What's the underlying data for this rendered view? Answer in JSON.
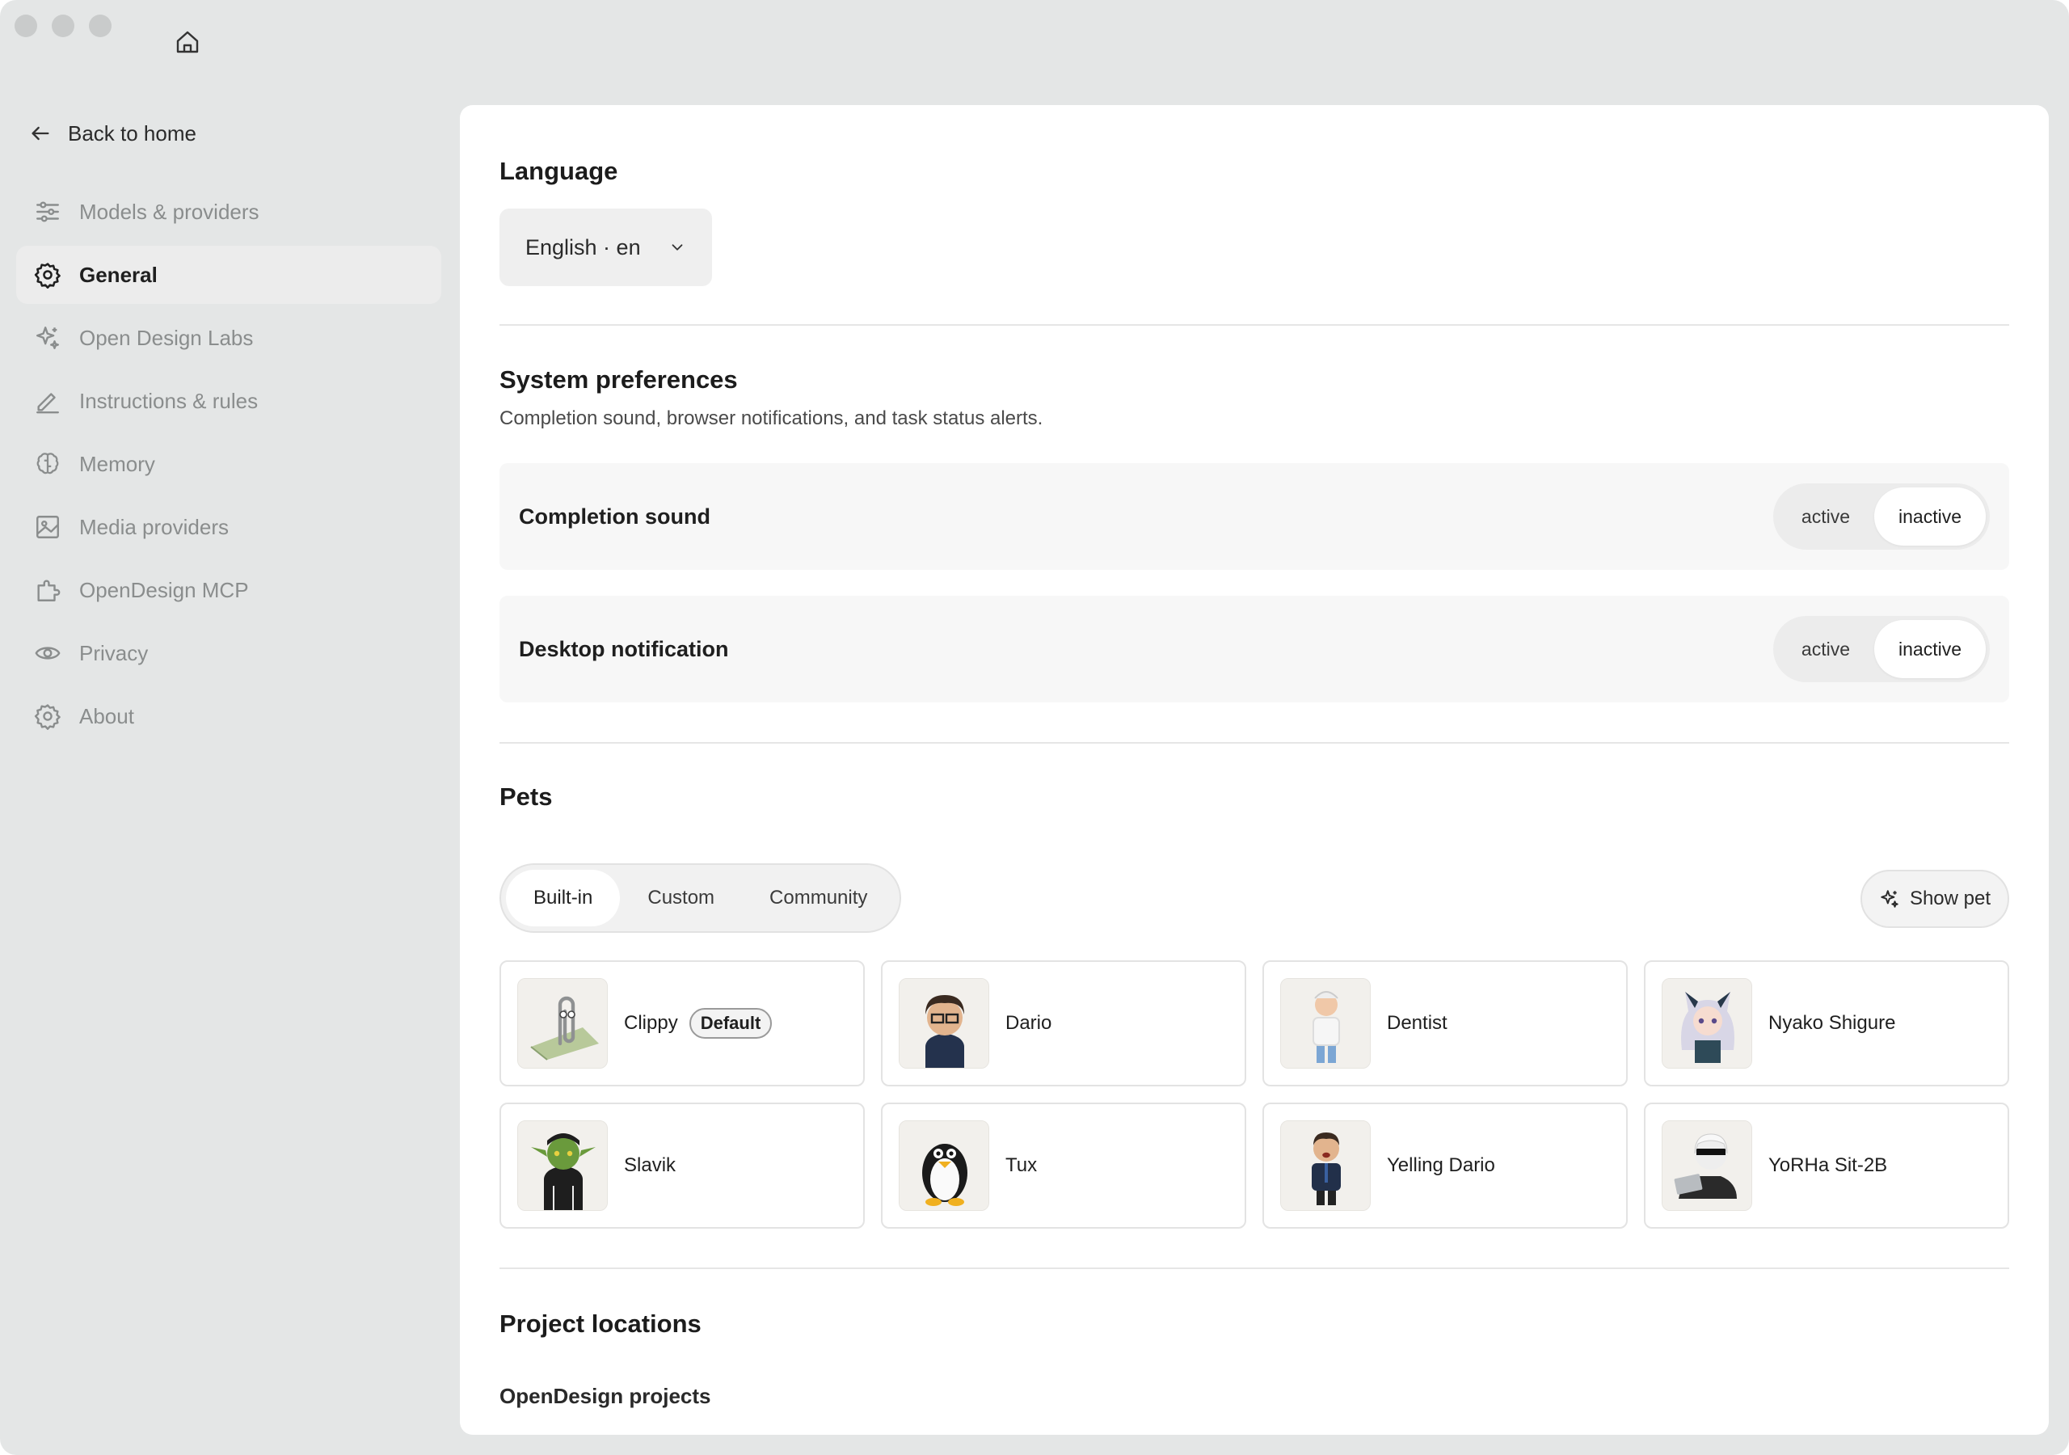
{
  "sidebar": {
    "back_label": "Back to home",
    "items": [
      {
        "label": "Models & providers",
        "icon": "sliders-icon"
      },
      {
        "label": "General",
        "icon": "gear-icon",
        "active": true
      },
      {
        "label": "Open Design Labs",
        "icon": "sparkles-icon"
      },
      {
        "label": "Instructions & rules",
        "icon": "pencil-icon"
      },
      {
        "label": "Memory",
        "icon": "brain-icon"
      },
      {
        "label": "Media providers",
        "icon": "image-icon"
      },
      {
        "label": "OpenDesign MCP",
        "icon": "plugin-icon"
      },
      {
        "label": "Privacy",
        "icon": "eye-icon"
      },
      {
        "label": "About",
        "icon": "gear-icon"
      }
    ]
  },
  "language": {
    "title": "Language",
    "selected": "English · en"
  },
  "system": {
    "title": "System preferences",
    "description": "Completion sound, browser notifications, and task status alerts.",
    "rows": [
      {
        "label": "Completion sound",
        "active_label": "active",
        "inactive_label": "inactive",
        "value": "inactive"
      },
      {
        "label": "Desktop notification",
        "active_label": "active",
        "inactive_label": "inactive",
        "value": "inactive"
      }
    ]
  },
  "pets": {
    "title": "Pets",
    "tabs": [
      "Built-in",
      "Custom",
      "Community"
    ],
    "selected_tab": "Built-in",
    "show_pet_label": "Show pet",
    "default_badge": "Default",
    "items": [
      {
        "name": "Clippy",
        "is_default": true
      },
      {
        "name": "Dario"
      },
      {
        "name": "Dentist"
      },
      {
        "name": "Nyako Shigure"
      },
      {
        "name": "Slavik"
      },
      {
        "name": "Tux"
      },
      {
        "name": "Yelling Dario"
      },
      {
        "name": "YoRHa Sit-2B"
      }
    ]
  },
  "locations": {
    "title": "Project locations",
    "subtitle": "OpenDesign projects"
  },
  "colors": {
    "window_bg": "#e4e6e6",
    "panel_bg": "#ffffff",
    "accent_text": "#1f1f1f",
    "muted_text": "#8a8d8d"
  }
}
